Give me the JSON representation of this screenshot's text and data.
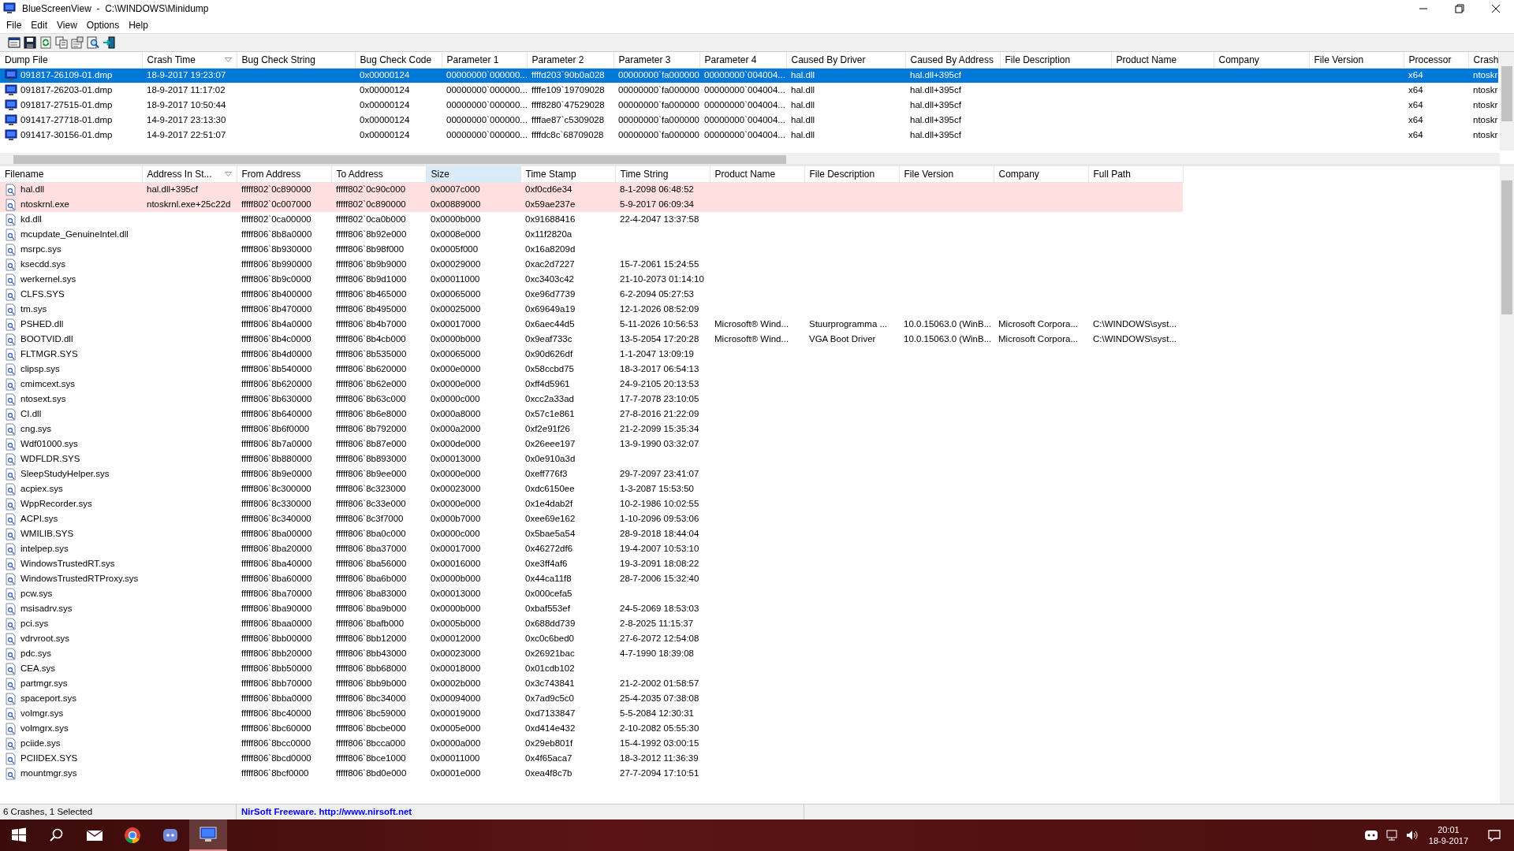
{
  "window": {
    "title": "BlueScreenView  -  C:\\WINDOWS\\Minidump"
  },
  "menu": [
    {
      "label": "File"
    },
    {
      "label": "Edit"
    },
    {
      "label": "View"
    },
    {
      "label": "Options"
    },
    {
      "label": "Help"
    }
  ],
  "crash_list": {
    "columns": [
      {
        "label": "Dump File",
        "sort_indicator": false
      },
      {
        "label": "Crash Time",
        "sort_indicator": true
      },
      {
        "label": "Bug Check String",
        "sort_indicator": false
      },
      {
        "label": "Bug Check Code",
        "sort_indicator": false
      },
      {
        "label": "Parameter 1",
        "sort_indicator": false
      },
      {
        "label": "Parameter 2",
        "sort_indicator": false
      },
      {
        "label": "Parameter 3",
        "sort_indicator": false
      },
      {
        "label": "Parameter 4",
        "sort_indicator": false
      },
      {
        "label": "Caused By Driver",
        "sort_indicator": false
      },
      {
        "label": "Caused By Address",
        "sort_indicator": false
      },
      {
        "label": "File Description",
        "sort_indicator": false
      },
      {
        "label": "Product Name",
        "sort_indicator": false
      },
      {
        "label": "Company",
        "sort_indicator": false
      },
      {
        "label": "File Version",
        "sort_indicator": false
      },
      {
        "label": "Processor",
        "sort_indicator": false
      },
      {
        "label": "Crash",
        "sort_indicator": false
      }
    ],
    "rows": [
      {
        "selected": true,
        "cells": [
          "091817-26109-01.dmp",
          "18-9-2017 19:23:07",
          null,
          "0x00000124",
          "00000000`000000...",
          "ffffd203`90b0a028",
          "00000000`fa000000",
          "00000000`004004...",
          "hal.dll",
          "hal.dll+395cf",
          null,
          null,
          null,
          null,
          "x64",
          "ntoskr"
        ]
      },
      {
        "selected": false,
        "cells": [
          "091817-26203-01.dmp",
          "18-9-2017 11:17:02",
          null,
          "0x00000124",
          "00000000`000000...",
          "ffffe109`19709028",
          "00000000`fa000000",
          "00000000`004004...",
          "hal.dll",
          "hal.dll+395cf",
          null,
          null,
          null,
          null,
          "x64",
          "ntoskr"
        ]
      },
      {
        "selected": false,
        "cells": [
          "091817-27515-01.dmp",
          "18-9-2017 10:50:44",
          null,
          "0x00000124",
          "00000000`000000...",
          "ffff8280`47529028",
          "00000000`fa000000",
          "00000000`004004...",
          "hal.dll",
          "hal.dll+395cf",
          null,
          null,
          null,
          null,
          "x64",
          "ntoskr"
        ]
      },
      {
        "selected": false,
        "cells": [
          "091417-27718-01.dmp",
          "14-9-2017 23:13:30",
          null,
          "0x00000124",
          "00000000`000000...",
          "ffffae87`c5309028",
          "00000000`fa000000",
          "00000000`004004...",
          "hal.dll",
          "hal.dll+395cf",
          null,
          null,
          null,
          null,
          "x64",
          "ntoskr"
        ]
      },
      {
        "selected": false,
        "cells": [
          "091417-30156-01.dmp",
          "14-9-2017 22:51:07",
          null,
          "0x00000124",
          "00000000`000000...",
          "ffffdc8c`68709028",
          "00000000`fa000000",
          "00000000`004004...",
          "hal.dll",
          "hal.dll+395cf",
          null,
          null,
          null,
          null,
          "x64",
          "ntoskr"
        ]
      }
    ]
  },
  "module_list": {
    "columns": [
      {
        "label": "Filename",
        "sort_indicator": false,
        "hot": false
      },
      {
        "label": "Address In St...",
        "sort_indicator": true,
        "hot": false
      },
      {
        "label": "From Address",
        "sort_indicator": false,
        "hot": false
      },
      {
        "label": "To Address",
        "sort_indicator": false,
        "hot": false
      },
      {
        "label": "Size",
        "sort_indicator": false,
        "hot": true
      },
      {
        "label": "Time Stamp",
        "sort_indicator": false,
        "hot": false
      },
      {
        "label": "Time String",
        "sort_indicator": false,
        "hot": false
      },
      {
        "label": "Product Name",
        "sort_indicator": false,
        "hot": false
      },
      {
        "label": "File Description",
        "sort_indicator": false,
        "hot": false
      },
      {
        "label": "File Version",
        "sort_indicator": false,
        "hot": false
      },
      {
        "label": "Company",
        "sort_indicator": false,
        "hot": false
      },
      {
        "label": "Full Path",
        "sort_indicator": false,
        "hot": false
      }
    ],
    "rows": [
      {
        "in_crash_stack": true,
        "cells": [
          "hal.dll",
          "hal.dll+395cf",
          "fffff802`0c890000",
          "fffff802`0c90c000",
          "0x0007c000",
          "0xf0cd6e34",
          "8-1-2098 06:48:52"
        ]
      },
      {
        "in_crash_stack": true,
        "cells": [
          "ntoskrnl.exe",
          "ntoskrnl.exe+25c22d",
          "fffff802`0c007000",
          "fffff802`0c890000",
          "0x00889000",
          "0x59ae237e",
          "5-9-2017 06:09:34"
        ]
      },
      {
        "in_crash_stack": false,
        "cells": [
          "kd.dll",
          null,
          "fffff802`0ca00000",
          "fffff802`0ca0b000",
          "0x0000b000",
          "0x91688416",
          "22-4-2047 13:37:58"
        ]
      },
      {
        "in_crash_stack": false,
        "cells": [
          "mcupdate_GenuineIntel.dll",
          null,
          "fffff806`8b8a0000",
          "fffff806`8b92e000",
          "0x0008e000",
          "0x11f2820a",
          null
        ]
      },
      {
        "in_crash_stack": false,
        "cells": [
          "msrpc.sys",
          null,
          "fffff806`8b930000",
          "fffff806`8b98f000",
          "0x0005f000",
          "0x16a8209d",
          null
        ]
      },
      {
        "in_crash_stack": false,
        "cells": [
          "ksecdd.sys",
          null,
          "fffff806`8b990000",
          "fffff806`8b9b9000",
          "0x00029000",
          "0xac2d7227",
          "15-7-2061 15:24:55"
        ]
      },
      {
        "in_crash_stack": false,
        "cells": [
          "werkernel.sys",
          null,
          "fffff806`8b9c0000",
          "fffff806`8b9d1000",
          "0x00011000",
          "0xc3403c42",
          "21-10-2073 01:14:10"
        ]
      },
      {
        "in_crash_stack": false,
        "cells": [
          "CLFS.SYS",
          null,
          "fffff806`8b400000",
          "fffff806`8b465000",
          "0x00065000",
          "0xe96d7739",
          "6-2-2094 05:27:53"
        ]
      },
      {
        "in_crash_stack": false,
        "cells": [
          "tm.sys",
          null,
          "fffff806`8b470000",
          "fffff806`8b495000",
          "0x00025000",
          "0x69649a19",
          "12-1-2026 08:52:09"
        ]
      },
      {
        "in_crash_stack": false,
        "cells": [
          "PSHED.dll",
          null,
          "fffff806`8b4a0000",
          "fffff806`8b4b7000",
          "0x00017000",
          "0x6aec44d5",
          "5-11-2026 10:56:53",
          "Microsoft® Wind...",
          "Stuurprogramma ...",
          "10.0.15063.0 (WinB...",
          "Microsoft Corpora...",
          "C:\\WINDOWS\\syst..."
        ]
      },
      {
        "in_crash_stack": false,
        "cells": [
          "BOOTVID.dll",
          null,
          "fffff806`8b4c0000",
          "fffff806`8b4cb000",
          "0x0000b000",
          "0x9eaf733c",
          "13-5-2054 17:20:28",
          "Microsoft® Wind...",
          "VGA Boot Driver",
          "10.0.15063.0 (WinB...",
          "Microsoft Corpora...",
          "C:\\WINDOWS\\syst..."
        ]
      },
      {
        "in_crash_stack": false,
        "cells": [
          "FLTMGR.SYS",
          null,
          "fffff806`8b4d0000",
          "fffff806`8b535000",
          "0x00065000",
          "0x90d626df",
          "1-1-2047 13:09:19"
        ]
      },
      {
        "in_crash_stack": false,
        "cells": [
          "clipsp.sys",
          null,
          "fffff806`8b540000",
          "fffff806`8b620000",
          "0x000e0000",
          "0x58ccbd75",
          "18-3-2017 06:54:13"
        ]
      },
      {
        "in_crash_stack": false,
        "cells": [
          "cmimcext.sys",
          null,
          "fffff806`8b620000",
          "fffff806`8b62e000",
          "0x0000e000",
          "0xff4d5961",
          "24-9-2105 20:13:53"
        ]
      },
      {
        "in_crash_stack": false,
        "cells": [
          "ntosext.sys",
          null,
          "fffff806`8b630000",
          "fffff806`8b63c000",
          "0x0000c000",
          "0xcc2a33ad",
          "17-7-2078 23:10:05"
        ]
      },
      {
        "in_crash_stack": false,
        "cells": [
          "CI.dll",
          null,
          "fffff806`8b640000",
          "fffff806`8b6e8000",
          "0x000a8000",
          "0x57c1e861",
          "27-8-2016 21:22:09"
        ]
      },
      {
        "in_crash_stack": false,
        "cells": [
          "cng.sys",
          null,
          "fffff806`8b6f0000",
          "fffff806`8b792000",
          "0x000a2000",
          "0xf2e91f26",
          "21-2-2099 15:35:34"
        ]
      },
      {
        "in_crash_stack": false,
        "cells": [
          "Wdf01000.sys",
          null,
          "fffff806`8b7a0000",
          "fffff806`8b87e000",
          "0x000de000",
          "0x26eee197",
          "13-9-1990 03:32:07"
        ]
      },
      {
        "in_crash_stack": false,
        "cells": [
          "WDFLDR.SYS",
          null,
          "fffff806`8b880000",
          "fffff806`8b893000",
          "0x00013000",
          "0x0e910a3d",
          null
        ]
      },
      {
        "in_crash_stack": false,
        "cells": [
          "SleepStudyHelper.sys",
          null,
          "fffff806`8b9e0000",
          "fffff806`8b9ee000",
          "0x0000e000",
          "0xeff776f3",
          "29-7-2097 23:41:07"
        ]
      },
      {
        "in_crash_stack": false,
        "cells": [
          "acpiex.sys",
          null,
          "fffff806`8c300000",
          "fffff806`8c323000",
          "0x00023000",
          "0xdc6150ee",
          "1-3-2087 15:53:50"
        ]
      },
      {
        "in_crash_stack": false,
        "cells": [
          "WppRecorder.sys",
          null,
          "fffff806`8c330000",
          "fffff806`8c33e000",
          "0x0000e000",
          "0x1e4dab2f",
          "10-2-1986 10:02:55"
        ]
      },
      {
        "in_crash_stack": false,
        "cells": [
          "ACPI.sys",
          null,
          "fffff806`8c340000",
          "fffff806`8c3f7000",
          "0x000b7000",
          "0xee69e162",
          "1-10-2096 09:53:06"
        ]
      },
      {
        "in_crash_stack": false,
        "cells": [
          "WMILIB.SYS",
          null,
          "fffff806`8ba00000",
          "fffff806`8ba0c000",
          "0x0000c000",
          "0x5bae5a54",
          "28-9-2018 18:44:04"
        ]
      },
      {
        "in_crash_stack": false,
        "cells": [
          "intelpep.sys",
          null,
          "fffff806`8ba20000",
          "fffff806`8ba37000",
          "0x00017000",
          "0x46272df6",
          "19-4-2007 10:53:10"
        ]
      },
      {
        "in_crash_stack": false,
        "cells": [
          "WindowsTrustedRT.sys",
          null,
          "fffff806`8ba40000",
          "fffff806`8ba56000",
          "0x00016000",
          "0xe3ff4af6",
          "19-3-2091 18:08:22"
        ]
      },
      {
        "in_crash_stack": false,
        "cells": [
          "WindowsTrustedRTProxy.sys",
          null,
          "fffff806`8ba60000",
          "fffff806`8ba6b000",
          "0x0000b000",
          "0x44ca11f8",
          "28-7-2006 15:32:40"
        ]
      },
      {
        "in_crash_stack": false,
        "cells": [
          "pcw.sys",
          null,
          "fffff806`8ba70000",
          "fffff806`8ba83000",
          "0x00013000",
          "0x000cefa5",
          null
        ]
      },
      {
        "in_crash_stack": false,
        "cells": [
          "msisadrv.sys",
          null,
          "fffff806`8ba90000",
          "fffff806`8ba9b000",
          "0x0000b000",
          "0xbaf553ef",
          "24-5-2069 18:53:03"
        ]
      },
      {
        "in_crash_stack": false,
        "cells": [
          "pci.sys",
          null,
          "fffff806`8baa0000",
          "fffff806`8bafb000",
          "0x0005b000",
          "0x688dd739",
          "2-8-2025 11:15:37"
        ]
      },
      {
        "in_crash_stack": false,
        "cells": [
          "vdrvroot.sys",
          null,
          "fffff806`8bb00000",
          "fffff806`8bb12000",
          "0x00012000",
          "0xc0c6bed0",
          "27-6-2072 12:54:08"
        ]
      },
      {
        "in_crash_stack": false,
        "cells": [
          "pdc.sys",
          null,
          "fffff806`8bb20000",
          "fffff806`8bb43000",
          "0x00023000",
          "0x26921bac",
          "4-7-1990 18:39:08"
        ]
      },
      {
        "in_crash_stack": false,
        "cells": [
          "CEA.sys",
          null,
          "fffff806`8bb50000",
          "fffff806`8bb68000",
          "0x00018000",
          "0x01cdb102",
          null
        ]
      },
      {
        "in_crash_stack": false,
        "cells": [
          "partmgr.sys",
          null,
          "fffff806`8bb70000",
          "fffff806`8bb9b000",
          "0x0002b000",
          "0x3c743841",
          "21-2-2002 01:58:57"
        ]
      },
      {
        "in_crash_stack": false,
        "cells": [
          "spaceport.sys",
          null,
          "fffff806`8bba0000",
          "fffff806`8bc34000",
          "0x00094000",
          "0x7ad9c5c0",
          "25-4-2035 07:38:08"
        ]
      },
      {
        "in_crash_stack": false,
        "cells": [
          "volmgr.sys",
          null,
          "fffff806`8bc40000",
          "fffff806`8bc59000",
          "0x00019000",
          "0xd7133847",
          "5-5-2084 12:30:31"
        ]
      },
      {
        "in_crash_stack": false,
        "cells": [
          "volmgrx.sys",
          null,
          "fffff806`8bc60000",
          "fffff806`8bcbe000",
          "0x0005e000",
          "0xd414e432",
          "2-10-2082 05:55:30"
        ]
      },
      {
        "in_crash_stack": false,
        "cells": [
          "pciide.sys",
          null,
          "fffff806`8bcc0000",
          "fffff806`8bcca000",
          "0x0000a000",
          "0x29eb801f",
          "15-4-1992 03:00:15"
        ]
      },
      {
        "in_crash_stack": false,
        "cells": [
          "PCIIDEX.SYS",
          null,
          "fffff806`8bcd0000",
          "fffff806`8bce1000",
          "0x00011000",
          "0x4f65aca7",
          "18-3-2012 11:36:39"
        ]
      },
      {
        "in_crash_stack": false,
        "cells": [
          "mountmgr.sys",
          null,
          "fffff806`8bcf0000",
          "fffff806`8bd0e000",
          "0x0001e000",
          "0xea4f8c7b",
          "27-7-2094 17:10:51"
        ]
      }
    ]
  },
  "status_bar": {
    "count": "6 Crashes, 1 Selected",
    "credit": "NirSoft Freeware.  http://www.nirsoft.net"
  },
  "taskbar": {
    "time": "20:01",
    "date": "18-9-2017"
  }
}
